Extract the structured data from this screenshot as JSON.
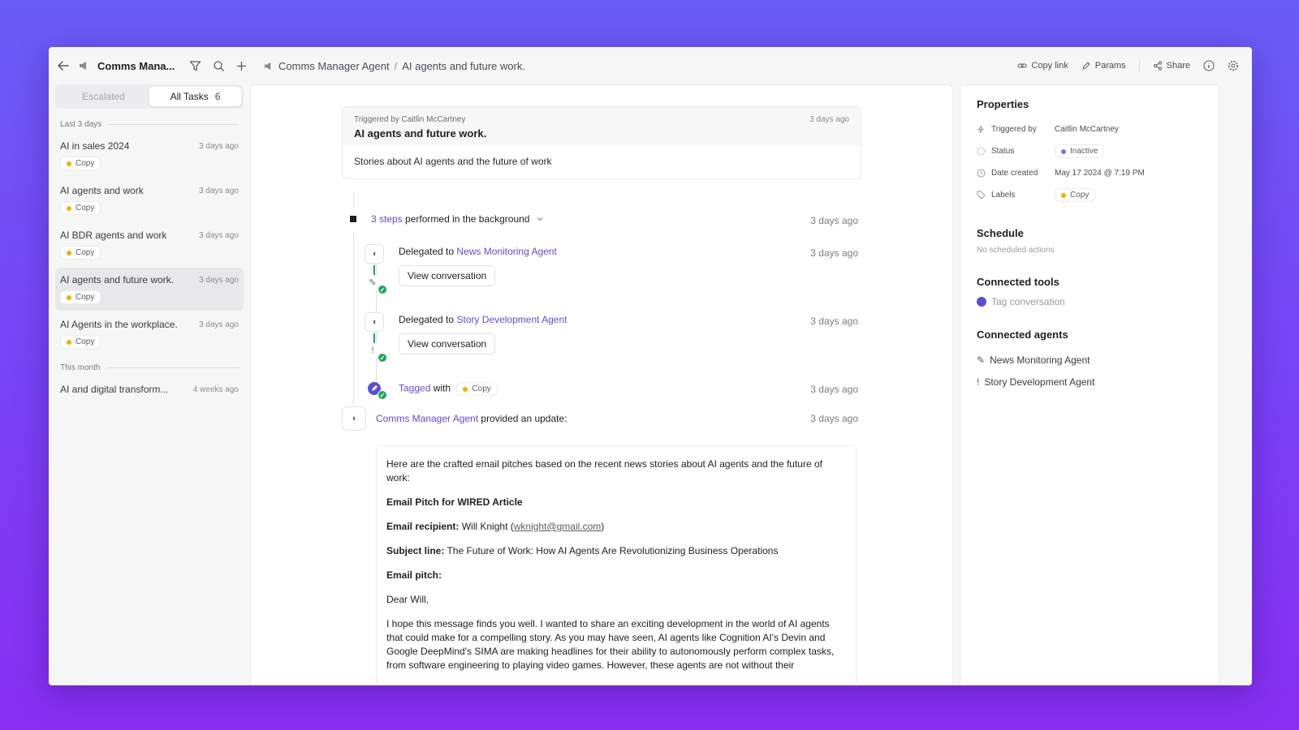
{
  "app": {
    "title": "Comms Mana...",
    "breadcrumb": [
      "Comms Manager Agent",
      "AI agents and future work."
    ],
    "actions": {
      "copy_link": "Copy link",
      "params": "Params",
      "share": "Share"
    }
  },
  "sidebar": {
    "tabs": [
      {
        "label": "Escalated"
      },
      {
        "label": "All Tasks",
        "count": "6"
      }
    ],
    "groups": [
      {
        "label": "Last 3 days",
        "tasks": [
          {
            "name": "AI in sales 2024",
            "time": "3 days ago",
            "label": "Copy"
          },
          {
            "name": "AI agents and work",
            "time": "3 days ago",
            "label": "Copy"
          },
          {
            "name": "AI BDR agents and work",
            "time": "3 days ago",
            "label": "Copy"
          },
          {
            "name": "AI agents and future work.",
            "time": "3 days ago",
            "label": "Copy"
          },
          {
            "name": "AI Agents in the workplace.",
            "time": "3 days ago",
            "label": "Copy"
          }
        ]
      },
      {
        "label": "This month",
        "tasks": [
          {
            "name": "AI and digital transform...",
            "time": "4 weeks ago"
          }
        ]
      }
    ]
  },
  "trigger": {
    "by": "Triggered by Caitlin McCartney",
    "title": "AI agents and future work.",
    "time": "3 days ago",
    "body": "Stories about AI agents and the future of work"
  },
  "steps": {
    "count_link": "3 steps",
    "summary": "performed in the background",
    "time": "3 days ago",
    "items": [
      {
        "prefix": "Delegated to",
        "agent": "News Monitoring Agent",
        "time": "3 days ago",
        "button": "View conversation"
      },
      {
        "prefix": "Delegated to",
        "agent": "Story Development Agent",
        "time": "3 days ago",
        "button": "View conversation"
      },
      {
        "prefix": "Tagged",
        "suffix": "with",
        "label": "Copy",
        "time": "3 days ago"
      }
    ]
  },
  "update": {
    "agent": "Comms Manager Agent",
    "text": "provided an update:",
    "time": "3 days ago",
    "intro": "Here are the crafted email pitches based on the recent news stories about AI agents and the future of work:",
    "heading": "Email Pitch for WIRED Article",
    "recipient_label": "Email recipient:",
    "recipient_name": "Will Knight (",
    "recipient_email": "wknight@gmail.com",
    "recipient_close": ")",
    "subject_label": "Subject line:",
    "subject": "The Future of Work: How AI Agents Are Revolutionizing Business Operations",
    "pitch_label": "Email pitch:",
    "greeting": "Dear Will,",
    "paragraph": "I hope this message finds you well. I wanted to share an exciting development in the world of AI agents that could make for a compelling story. As you may have seen, AI agents like Cognition AI's Devin and Google DeepMind's SIMA are making headlines for their ability to autonomously perform complex tasks, from software engineering to playing video games. However, these agents are not without their"
  },
  "panel": {
    "properties_title": "Properties",
    "properties": {
      "triggered_by": {
        "key": "Triggered by",
        "value": "Caitlin McCartney"
      },
      "status": {
        "key": "Status",
        "value": "Inactive"
      },
      "date_created": {
        "key": "Date created",
        "value": "May 17 2024 @ 7:19 PM"
      },
      "labels": {
        "key": "Labels",
        "value": "Copy"
      }
    },
    "schedule_title": "Schedule",
    "schedule_empty": "No scheduled actions",
    "tools_title": "Connected tools",
    "tools": [
      "Tag conversation"
    ],
    "agents_title": "Connected agents",
    "agents": [
      "News Monitoring Agent",
      "Story Development Agent"
    ]
  },
  "colors": {
    "accent": "#5b4fd0",
    "label_dot": "#e8b400",
    "status_dot": "#7b74e0",
    "success": "#22a55a"
  }
}
